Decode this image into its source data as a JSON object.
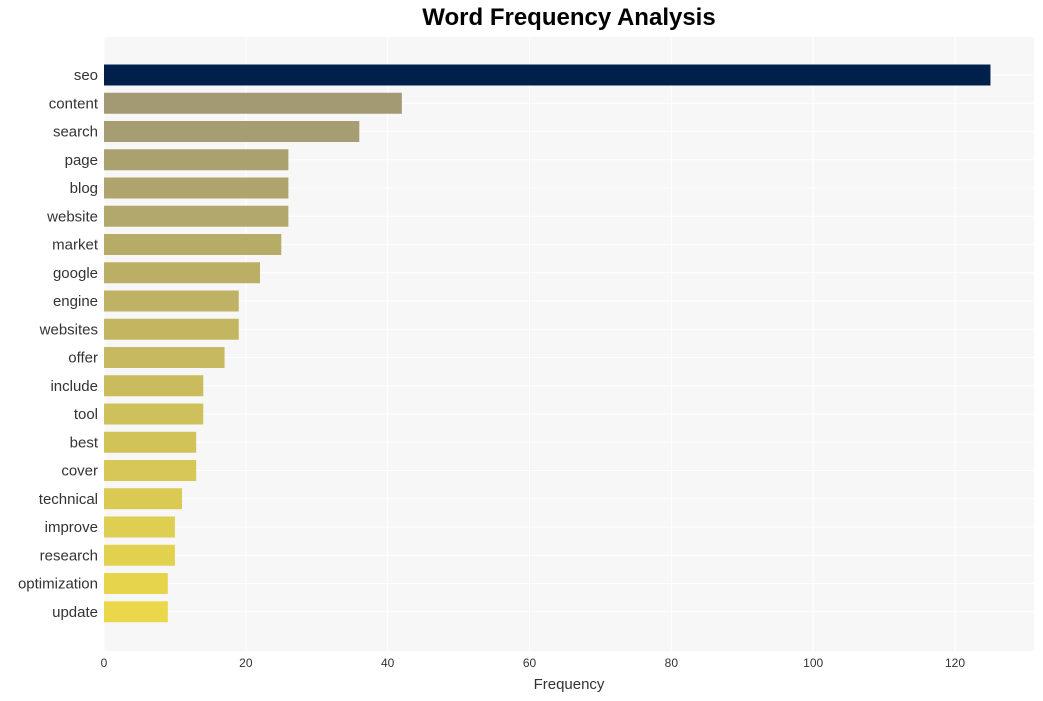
{
  "chart_data": {
    "type": "bar",
    "orientation": "horizontal",
    "title": "Word Frequency Analysis",
    "xlabel": "Frequency",
    "ylabel": "",
    "xlim": [
      0,
      131
    ],
    "xticks": [
      0,
      20,
      40,
      60,
      80,
      100,
      120
    ],
    "grid": true,
    "legend": "none",
    "categories": [
      "seo",
      "content",
      "search",
      "page",
      "blog",
      "website",
      "market",
      "google",
      "engine",
      "websites",
      "offer",
      "include",
      "tool",
      "best",
      "cover",
      "technical",
      "improve",
      "research",
      "optimization",
      "update"
    ],
    "values": [
      125,
      42,
      36,
      26,
      26,
      26,
      25,
      22,
      19,
      19,
      17,
      14,
      14,
      13,
      13,
      11,
      10,
      10,
      9,
      9
    ],
    "colors": {
      "top_bar": "#00204c",
      "gradient_start": "#a39a74",
      "gradient_end": "#ead84a",
      "plot_background": "#f7f7f7",
      "grid": "#ffffff"
    }
  }
}
